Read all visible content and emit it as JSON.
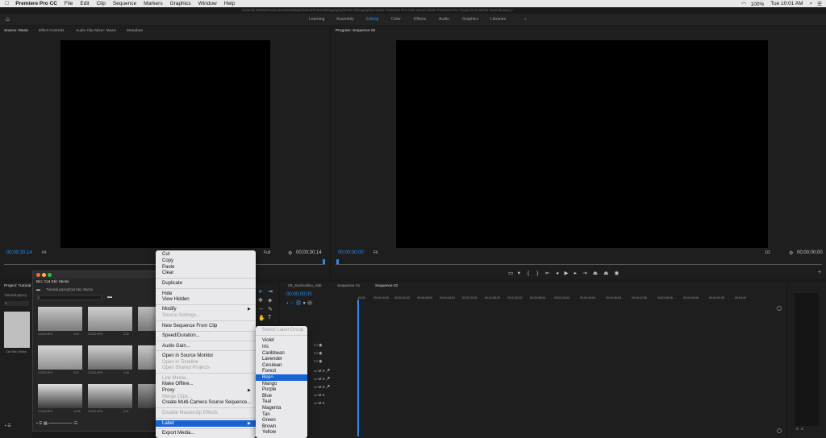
{
  "menubar": {
    "apple": "",
    "app": "Premiere Pro CC",
    "items": [
      "File",
      "Edit",
      "Clip",
      "Sequence",
      "Markers",
      "Graphics",
      "Window",
      "Help"
    ],
    "clock": "Tue 10:01 AM",
    "battery": "100%"
  },
  "title_path": "/Users/LiveMSIProductions/Desktop/Video/Photo/Videography/Work Videography/Adobe Premiere Pro Auto-Save/Adobe Premiere Pro Project/Cat Sticks Tutorial.prproj *",
  "workspaces": [
    "Learning",
    "Assembly",
    "Editing",
    "Color",
    "Effects",
    "Audio",
    "Graphics",
    "Libraries"
  ],
  "workspace_more": "»",
  "source": {
    "tabs": [
      "Source: Music",
      "Effect Controls",
      "Audio Clip Mixer: Music",
      "Metadata"
    ],
    "timecode_in": "00;00;30;14",
    "fit": "Fit",
    "full": "Full",
    "timecode_out": "00;00;30;14"
  },
  "program": {
    "tab": "Program: Sequence 02",
    "timecode": "00;00;00;00",
    "fit": "Fit",
    "ratio": "1/2",
    "timecode_out": "00;00;00;00"
  },
  "project": {
    "tab": "Project: Tutorial",
    "file": "Tutorial.prproj",
    "item_label": "Cat Stic Sticks"
  },
  "bin": {
    "title": "Bin: Cat Stic Sticks",
    "path": "Tutorial.prproj\\Cat Stic Sticks",
    "thumb_labels": [
      "C0022.MP4",
      "C0023.MP4",
      "C0024.MP4",
      "C0025.MP4",
      "C0026.MP4",
      "C0027.MP4",
      "C0028.MP4",
      "C0029.MP4"
    ],
    "thumb_durations": [
      "3:09",
      "3:02",
      "0:22",
      "1:45",
      "14:05",
      "3:01"
    ]
  },
  "context_menu": {
    "items": [
      {
        "label": "Cut",
        "disabled": false
      },
      {
        "label": "Copy",
        "disabled": false
      },
      {
        "label": "Paste",
        "disabled": false
      },
      {
        "label": "Clear",
        "disabled": false
      },
      {
        "label": "Duplicate",
        "disabled": false
      },
      {
        "label": "Hide",
        "disabled": false
      },
      {
        "label": "View Hidden",
        "disabled": false
      },
      {
        "label": "Modify",
        "disabled": false,
        "submenu": true
      },
      {
        "label": "Source Settings...",
        "disabled": true
      },
      {
        "label": "New Sequence From Clip",
        "disabled": false
      },
      {
        "label": "Speed/Duration...",
        "disabled": false
      },
      {
        "label": "Audio Gain...",
        "disabled": false
      },
      {
        "label": "Open in Source Monitor",
        "disabled": false
      },
      {
        "label": "Open in Timeline",
        "disabled": true
      },
      {
        "label": "Open Shared Projects",
        "disabled": true
      },
      {
        "label": "Link Media...",
        "disabled": true
      },
      {
        "label": "Make Offline...",
        "disabled": false
      },
      {
        "label": "Proxy",
        "disabled": false,
        "submenu": true
      },
      {
        "label": "Merge Clips...",
        "disabled": true
      },
      {
        "label": "Create Multi-Camera Source Sequence...",
        "disabled": false
      },
      {
        "label": "Disable Masterclip Effects",
        "disabled": true
      },
      {
        "label": "Label",
        "disabled": false,
        "submenu": true,
        "highlighted": true
      },
      {
        "label": "Export Media...",
        "disabled": false
      }
    ]
  },
  "label_submenu": {
    "header": "Select Label Group",
    "items": [
      "Violet",
      "Iris",
      "Caribbean",
      "Lavender",
      "Cerulean",
      "Forest",
      "Rose",
      "Mango",
      "Purple",
      "Blue",
      "Teal",
      "Magenta",
      "Tan",
      "Green",
      "Brown",
      "Yellow"
    ],
    "highlighted": "Rose"
  },
  "timeline": {
    "tabs": [
      "03_SockVideo_15b",
      "Sequence 01",
      "Sequence 02"
    ],
    "timecode": "00;00;00;00",
    "ruler": [
      ":00;00",
      "00;00;16;00",
      "00;00;32;00",
      "00;00;48;00",
      "00;01;04;02",
      "00;01;20;02",
      "00;01;36;02",
      "00;01;52;02",
      "00;02;08;04",
      "00;02;24;04",
      "00;02;40;04",
      "00;02;56;04",
      "00;03;12;06",
      "00;03;28;06",
      "00;03;44;06",
      "00;04;00;08",
      "00;04;16"
    ]
  },
  "colors": {
    "accent": "#2d8ceb",
    "menu_highlight": "#1764d6",
    "menu_bg": "#e9e9eb"
  }
}
